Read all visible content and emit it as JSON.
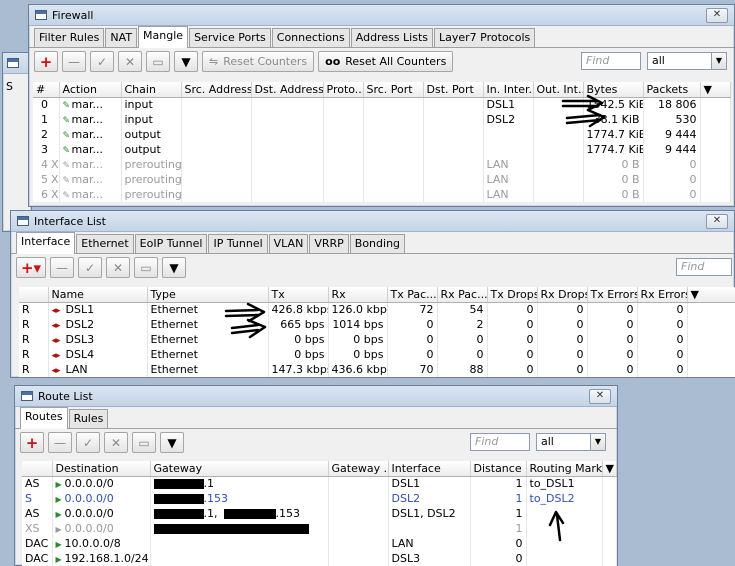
{
  "firewall": {
    "title": "Firewall",
    "tabs": [
      "Filter Rules",
      "NAT",
      "Mangle",
      "Service Ports",
      "Connections",
      "Address Lists",
      "Layer7 Protocols"
    ],
    "active_tab": "Mangle",
    "reset_counters": "Reset Counters",
    "reset_all_counters": "Reset All Counters",
    "find_placeholder": "Find",
    "filter_value": "all",
    "columns": [
      "#",
      "Action",
      "Chain",
      "Src. Address",
      "Dst. Address",
      "Proto...",
      "Src. Port",
      "Dst. Port",
      "In. Inter...",
      "Out. Int...",
      "Bytes",
      "Packets"
    ],
    "rows": [
      {
        "num": "0",
        "flag": "",
        "action": "mar...",
        "chain": "input",
        "in": "DSL1",
        "bytes": "1542.5 KiB",
        "packets": "18 806",
        "disabled": false
      },
      {
        "num": "1",
        "flag": "",
        "action": "mar...",
        "chain": "input",
        "in": "DSL2",
        "bytes": "38.1 KiB",
        "packets": "530",
        "disabled": false
      },
      {
        "num": "2",
        "flag": "",
        "action": "mar...",
        "chain": "output",
        "in": "",
        "bytes": "1774.7 KiB",
        "packets": "9 444",
        "disabled": false
      },
      {
        "num": "3",
        "flag": "",
        "action": "mar...",
        "chain": "output",
        "in": "",
        "bytes": "1774.7 KiB",
        "packets": "9 444",
        "disabled": false
      },
      {
        "num": "4",
        "flag": "X",
        "action": "mar...",
        "chain": "prerouting",
        "in": "LAN",
        "bytes": "0 B",
        "packets": "0",
        "disabled": true
      },
      {
        "num": "5",
        "flag": "X",
        "action": "mar...",
        "chain": "prerouting",
        "in": "LAN",
        "bytes": "0 B",
        "packets": "0",
        "disabled": true
      },
      {
        "num": "6",
        "flag": "X",
        "action": "mar...",
        "chain": "prerouting",
        "in": "LAN",
        "bytes": "0 B",
        "packets": "0",
        "disabled": true
      }
    ]
  },
  "interface_list": {
    "title": "Interface List",
    "tabs": [
      "Interface",
      "Ethernet",
      "EoIP Tunnel",
      "IP Tunnel",
      "VLAN",
      "VRRP",
      "Bonding"
    ],
    "active_tab": "Interface",
    "find_placeholder": "Find",
    "columns": [
      "Name",
      "Type",
      "Tx",
      "Rx",
      "Tx Pac...",
      "Rx Pac...",
      "Tx Drops",
      "Rx Drops",
      "Tx Errors",
      "Rx Errors"
    ],
    "rows": [
      {
        "flag": "R",
        "name": "DSL1",
        "type": "Ethernet",
        "tx": "426.8 kbps",
        "rx": "126.0 kbps",
        "txp": "72",
        "rxp": "54",
        "txd": "0",
        "rxd": "0",
        "txe": "0",
        "rxe": "0"
      },
      {
        "flag": "R",
        "name": "DSL2",
        "type": "Ethernet",
        "tx": "665 bps",
        "rx": "1014 bps",
        "txp": "0",
        "rxp": "2",
        "txd": "0",
        "rxd": "0",
        "txe": "0",
        "rxe": "0"
      },
      {
        "flag": "R",
        "name": "DSL3",
        "type": "Ethernet",
        "tx": "0 bps",
        "rx": "0 bps",
        "txp": "0",
        "rxp": "0",
        "txd": "0",
        "rxd": "0",
        "txe": "0",
        "rxe": "0"
      },
      {
        "flag": "R",
        "name": "DSL4",
        "type": "Ethernet",
        "tx": "0 bps",
        "rx": "0 bps",
        "txp": "0",
        "rxp": "0",
        "txd": "0",
        "rxd": "0",
        "txe": "0",
        "rxe": "0"
      },
      {
        "flag": "R",
        "name": "LAN",
        "type": "Ethernet",
        "tx": "147.3 kbps",
        "rx": "436.6 kbps",
        "txp": "70",
        "rxp": "88",
        "txd": "0",
        "rxd": "0",
        "txe": "0",
        "rxe": "0"
      }
    ]
  },
  "route_list": {
    "title": "Route List",
    "tabs": [
      "Routes",
      "Rules"
    ],
    "active_tab": "Routes",
    "find_placeholder": "Find",
    "filter_value": "all",
    "columns": [
      "Destination",
      "Gateway",
      "Gateway ...",
      "Interface",
      "Distance",
      "Routing Mark"
    ],
    "rows": [
      {
        "flag": "AS",
        "dst": "0.0.0.0/0",
        "gw_tail": ".1",
        "iface": "DSL1",
        "dist": "1",
        "mark": "to_DSL1",
        "style": "normal"
      },
      {
        "flag": "S",
        "dst": "0.0.0.0/0",
        "gw_tail": ".153",
        "iface": "DSL2",
        "dist": "1",
        "mark": "to_DSL2",
        "style": "blue"
      },
      {
        "flag": "AS",
        "dst": "0.0.0.0/0",
        "gw_tail": ".1,",
        "gw_tail2": ".153",
        "iface": "DSL1, DSL2",
        "dist": "1",
        "mark": "",
        "style": "normal"
      },
      {
        "flag": "XS",
        "dst": "0.0.0.0/0",
        "gw_tail": "",
        "iface": "",
        "dist": "1",
        "mark": "",
        "style": "disabled"
      },
      {
        "flag": "DAC",
        "dst": "10.0.0.0/8",
        "gw_tail": "",
        "iface": "LAN",
        "dist": "0",
        "mark": "",
        "style": "normal"
      },
      {
        "flag": "DAC",
        "dst": "192.168.1.0/24",
        "gw_tail": "",
        "iface": "DSL3",
        "dist": "0",
        "mark": "",
        "style": "normal"
      }
    ]
  },
  "background_window": {
    "tab_fragment": "S"
  }
}
